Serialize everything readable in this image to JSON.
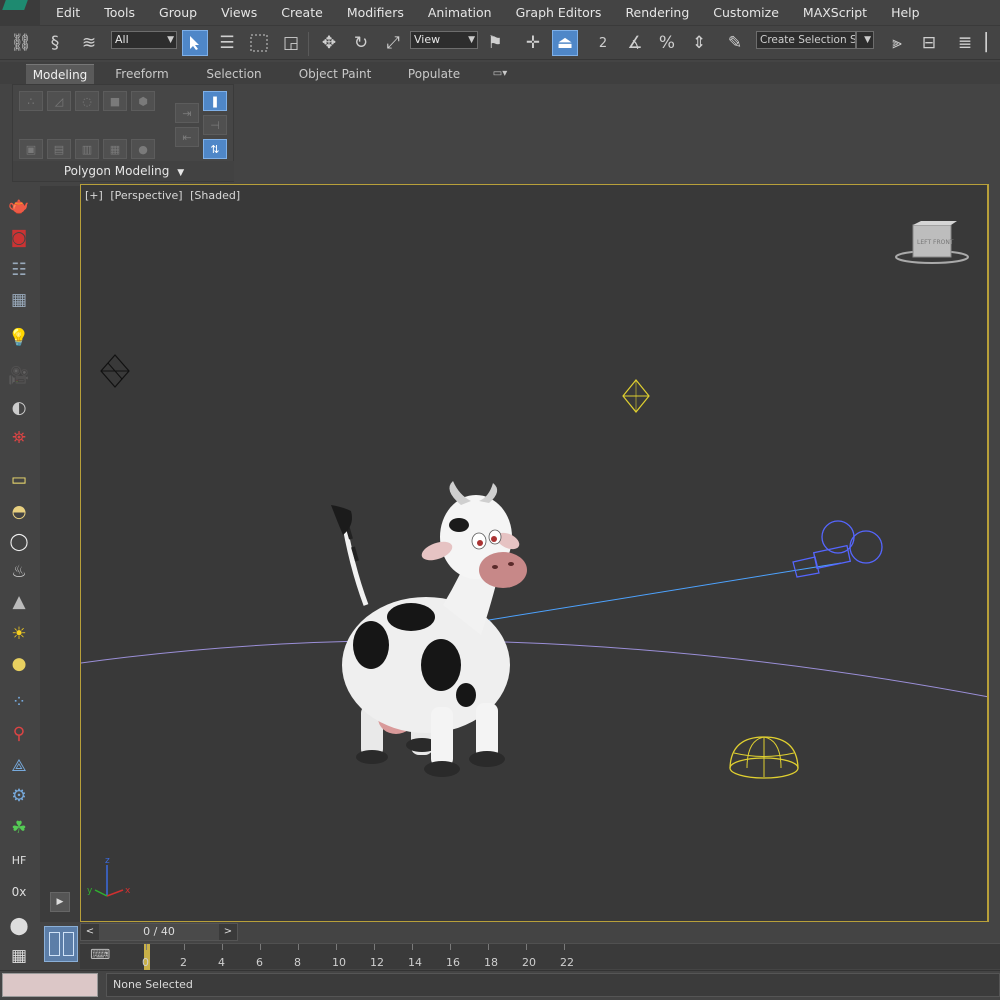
{
  "menu": {
    "items": [
      "Edit",
      "Tools",
      "Group",
      "Views",
      "Create",
      "Modifiers",
      "Animation",
      "Graph Editors",
      "Rendering",
      "Customize",
      "MAXScript",
      "Help"
    ]
  },
  "toolbar": {
    "selection_filter": "All",
    "reference_coord": "View",
    "snap_angle_label": "2",
    "named_selection_placeholder": "Create Selection Se"
  },
  "ribbon": {
    "tabs": [
      "Modeling",
      "Freeform",
      "Selection",
      "Object Paint",
      "Populate"
    ],
    "active_tab": "Modeling",
    "panel_label": "Polygon Modeling"
  },
  "viewport": {
    "label_plus": "[+]",
    "label_view": "[Perspective]",
    "label_shading": "[Shaded]",
    "axis_x": "x",
    "axis_y": "y",
    "axis_z": "z",
    "viewcube_left": "LEFT",
    "viewcube_front": "FRONT"
  },
  "timeline": {
    "current_frame_display": "0 / 40",
    "ticks": [
      "0",
      "2",
      "4",
      "6",
      "8",
      "10",
      "12",
      "14",
      "16",
      "18",
      "20",
      "22"
    ],
    "current_frame": 0,
    "total_frames": 40
  },
  "status": {
    "text": "None Selected"
  },
  "colors": {
    "viewport_border": "#b8a03a",
    "active_button": "#4f87c8",
    "light_gizmo": "#e0d030",
    "camera_gizmo": "#5566ff",
    "ground_line": "#9b8fd8"
  }
}
